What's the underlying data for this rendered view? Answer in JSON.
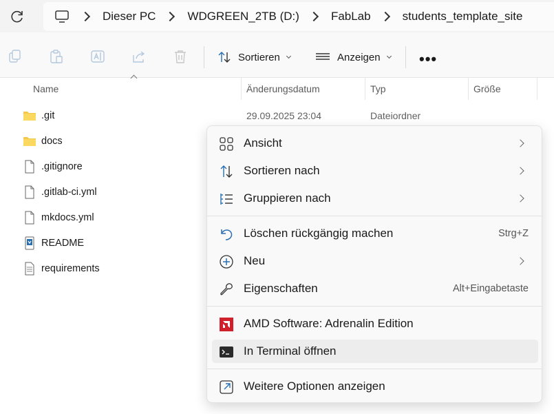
{
  "breadcrumb": {
    "items": [
      "Dieser PC",
      "WDGREEN_2TB (D:)",
      "FabLab",
      "students_template_site"
    ]
  },
  "toolbar": {
    "sort_label": "Sortieren",
    "view_label": "Anzeigen",
    "more_label": "•••"
  },
  "columns": {
    "name": "Name",
    "date": "Änderungsdatum",
    "type": "Typ",
    "size": "Größe"
  },
  "files": [
    {
      "name": ".git",
      "icon": "folder-icon",
      "date": "29.09.2025 23:04",
      "type": "Dateiordner"
    },
    {
      "name": "docs",
      "icon": "folder-icon",
      "date": "",
      "type": ""
    },
    {
      "name": ".gitignore",
      "icon": "file-icon",
      "date": "",
      "type": ""
    },
    {
      "name": ".gitlab-ci.yml",
      "icon": "file-icon",
      "date": "",
      "type": ""
    },
    {
      "name": "mkdocs.yml",
      "icon": "file-icon",
      "date": "",
      "type": ""
    },
    {
      "name": "README",
      "icon": "markdown-file-icon",
      "date": "",
      "type": ""
    },
    {
      "name": "requirements",
      "icon": "text-file-icon",
      "date": "",
      "type": ""
    }
  ],
  "context_menu": {
    "items": [
      {
        "label": "Ansicht",
        "icon": "view-grid-icon",
        "submenu": true
      },
      {
        "label": "Sortieren nach",
        "icon": "sort-icon",
        "submenu": true
      },
      {
        "label": "Gruppieren nach",
        "icon": "group-list-icon",
        "submenu": true
      },
      {
        "label": "Löschen rückgängig machen",
        "icon": "undo-icon",
        "shortcut": "Strg+Z"
      },
      {
        "label": "Neu",
        "icon": "new-plus-icon",
        "submenu": true
      },
      {
        "label": "Eigenschaften",
        "icon": "wrench-icon",
        "shortcut": "Alt+Eingabetaste"
      },
      {
        "label": "AMD Software: Adrenalin Edition",
        "icon": "amd-logo-icon"
      },
      {
        "label": "In Terminal öffnen",
        "icon": "terminal-icon",
        "highlighted": true
      },
      {
        "label": "Weitere Optionen anzeigen",
        "icon": "more-options-icon"
      }
    ]
  },
  "colors": {
    "folder": "#f4c84a",
    "amd_red": "#d0202c",
    "accent_blue": "#2a6fb0",
    "highlight": "#ededed"
  }
}
